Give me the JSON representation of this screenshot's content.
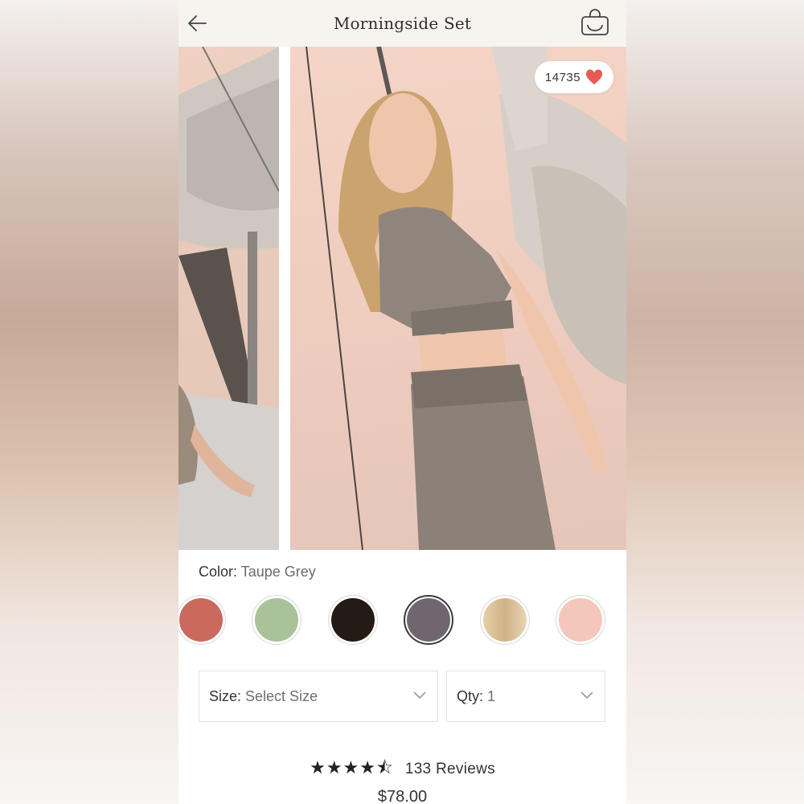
{
  "header": {
    "title": "Morningside Set"
  },
  "likes": {
    "count": "14735"
  },
  "color": {
    "label": "Color:",
    "value": "Taupe Grey"
  },
  "swatches": [
    {
      "name": "terracotta",
      "hex": "#c96a5c"
    },
    {
      "name": "sage",
      "hex": "#a9c29a"
    },
    {
      "name": "black",
      "hex": "#231b14"
    },
    {
      "name": "taupe-grey",
      "hex": "#6f6670",
      "selected": true
    },
    {
      "name": "sand",
      "hex": "#dcc39a"
    },
    {
      "name": "blush",
      "hex": "#f4c7bb"
    }
  ],
  "size": {
    "label": "Size:",
    "value": "Select Size"
  },
  "qty": {
    "label": "Qty:",
    "value": "1"
  },
  "rating": {
    "stars": "★★★★⯪",
    "value": 4.5,
    "reviews": "133 Reviews"
  },
  "price": "$78.00",
  "colors": {
    "accent_heart": "#e85a4f",
    "topbar_bg": "#f6f4ef"
  }
}
